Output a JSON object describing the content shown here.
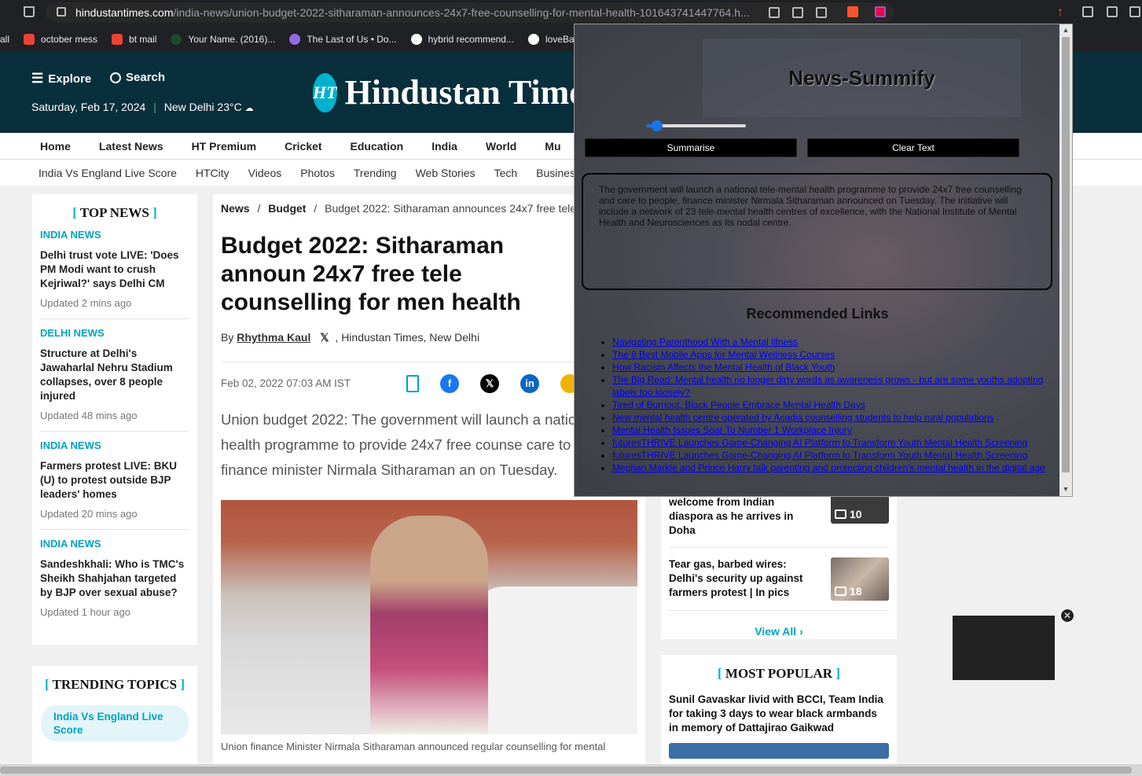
{
  "browser": {
    "url_host": "hindustantimes.com",
    "url_path": "/india-news/union-budget-2022-sitharaman-announces-24x7-free-counselling-for-mental-health-101643741447764.h...",
    "bookmarks": [
      "all",
      "october mess",
      "bt mail",
      "Your Name. (2016)...",
      "The Last of Us • Do...",
      "hybrid recommend...",
      "loveBabb"
    ]
  },
  "header": {
    "explore": "Explore",
    "search": "Search",
    "date": "Saturday, Feb 17, 2024",
    "weather": "New Delhi 23°C",
    "logo_mark": "HT",
    "logo_text": "Hindustan Times"
  },
  "nav_primary": [
    "Home",
    "Latest News",
    "HT Premium",
    "Cricket",
    "Education",
    "India",
    "World",
    "Mu"
  ],
  "nav_secondary": [
    "India Vs England Live Score",
    "HTCity",
    "Videos",
    "Photos",
    "Trending",
    "Web Stories",
    "Tech",
    "Business"
  ],
  "top_news": {
    "heading": "TOP NEWS",
    "items": [
      {
        "category": "INDIA NEWS",
        "title": "Delhi trust vote LIVE: 'Does PM Modi want to crush Kejriwal?' says Delhi CM",
        "time": "Updated 2 mins ago"
      },
      {
        "category": "DELHI NEWS",
        "title": "Structure at Delhi's Jawaharlal Nehru Stadium collapses, over 8 people injured",
        "time": "Updated 48 mins ago"
      },
      {
        "category": "INDIA NEWS",
        "title": "Farmers protest LIVE: BKU (U) to protest outside BJP leaders' homes",
        "time": "Updated 20 mins ago"
      },
      {
        "category": "INDIA NEWS",
        "title": "Sandeshkhali: Who is TMC's Sheikh Shahjahan targeted by BJP over sexual abuse?",
        "time": "Updated 1 hour ago"
      }
    ]
  },
  "trending": {
    "heading": "TRENDING TOPICS",
    "pill": "India Vs England Live Score"
  },
  "article": {
    "crumb_news": "News",
    "crumb_budget": "Budget",
    "crumb_current": "Budget 2022: Sitharaman announces 24x7 free tele co",
    "headline": "Budget 2022: Sitharaman announ 24x7 free tele counselling for men health",
    "by": "By",
    "author": "Rhythma Kaul",
    "outlet": ", Hindustan Times, New Delhi",
    "date": "Feb 02, 2022 07:03 AM IST",
    "summary": "Union budget 2022: The government will launch a natio mental health programme to provide 24x7 free counse care to people, finance minister Nirmala Sitharaman an on Tuesday.",
    "caption": "Union finance Minister Nirmala Sitharaman announced regular counselling for mental"
  },
  "photo_gallery": {
    "items": [
      {
        "title": "welcome from Indian diaspora as he arrives in Doha",
        "count": "10"
      },
      {
        "title": "Tear gas, barbed wires: Delhi's security up against farmers protest | In pics",
        "count": "18"
      }
    ],
    "view_all": "View All"
  },
  "most_popular": {
    "heading": "MOST POPULAR",
    "title": "Sunil Gavaskar livid with BCCI, Team India for taking 3 days to wear black armbands in memory of Dattajirao Gaikwad"
  },
  "popup": {
    "title": "News-Summify",
    "slider_value": 0.05,
    "summarise": "Summarise",
    "clear": "Clear Text",
    "summary_text": "The government will launch a national tele-mental health programme to provide 24x7 free counselling and care to people, finance minister Nirmala Sitharaman announced on Tuesday. The initiative will include a network of 23 tele-mental health centres of excellence, with the National Institute of Mental Health and Neurosciences as its nodal centre.",
    "rec_heading": "Recommended Links",
    "links": [
      "Navigating Parenthood With a Mental Illness",
      "The 8 Best Mobile Apps for Mental Wellness Courses",
      "How Racism Affects the Mental Health of Black Youth",
      "The Big Read: Mental health no longer dirty words as awareness grows - but are some youths adopting labels too loosely?",
      "Tired of Burnout, Black People Embrace Mental Health Days",
      "New mental health centre operated by Acadia counselling students to help rural populations",
      "Mental Health Issues Soar To Number 1 Workplace Injury",
      "futuresTHRIVE Launches Game-Changing AI Platform to Transform Youth Mental Health Screening",
      "futuresTHRIVE Launches Game-Changing AI Platform to Transform Youth Mental Health Screening",
      "Meghan Markle and Prince Harry talk parenting and protecting children's mental health in the digital age"
    ]
  },
  "colors": {
    "accent": "#00a3c0",
    "header_bg": "#0a2f3c",
    "popup_btn": "#000000"
  }
}
